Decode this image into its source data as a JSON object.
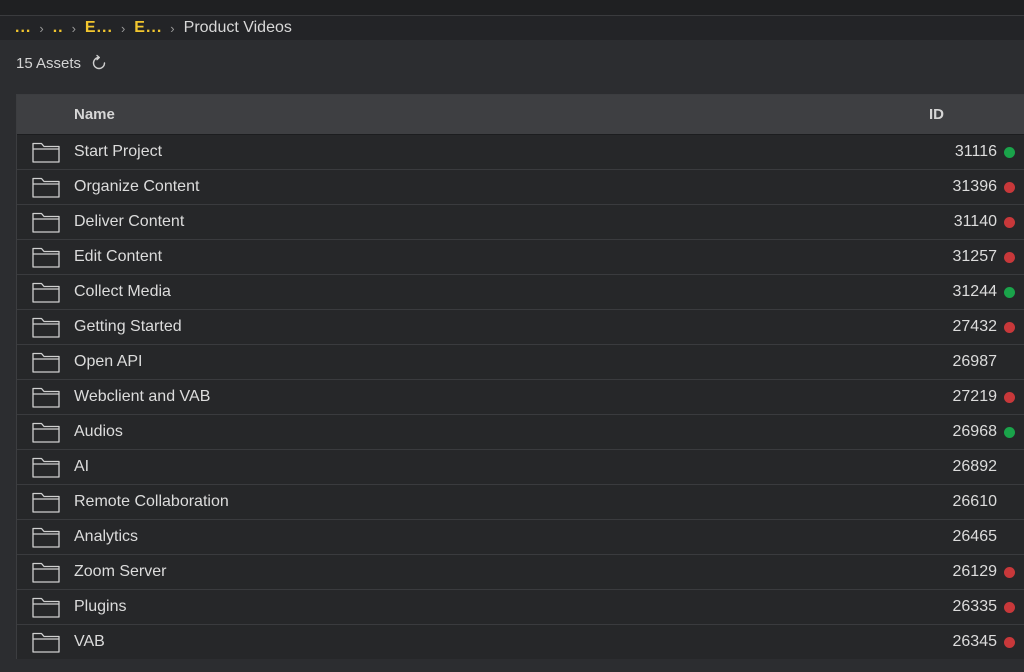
{
  "breadcrumb": {
    "items": [
      {
        "label": "...",
        "type": "link"
      },
      {
        "label": "..",
        "type": "link"
      },
      {
        "label": "E...",
        "type": "link"
      },
      {
        "label": "E...",
        "type": "link"
      },
      {
        "label": "Product Videos",
        "type": "current"
      }
    ],
    "separator": "›"
  },
  "assets": {
    "count_label": "15 Assets"
  },
  "table": {
    "columns": {
      "name": "Name",
      "id": "ID"
    },
    "rows": [
      {
        "name": "Start Project",
        "id": "31116",
        "status": "green"
      },
      {
        "name": "Organize Content",
        "id": "31396",
        "status": "red"
      },
      {
        "name": "Deliver Content",
        "id": "31140",
        "status": "red"
      },
      {
        "name": "Edit Content",
        "id": "31257",
        "status": "red"
      },
      {
        "name": "Collect Media",
        "id": "31244",
        "status": "green"
      },
      {
        "name": "Getting Started",
        "id": "27432",
        "status": "red"
      },
      {
        "name": "Open API",
        "id": "26987",
        "status": "none"
      },
      {
        "name": "Webclient and VAB",
        "id": "27219",
        "status": "red"
      },
      {
        "name": "Audios",
        "id": "26968",
        "status": "green"
      },
      {
        "name": "AI",
        "id": "26892",
        "status": "none"
      },
      {
        "name": "Remote Collaboration",
        "id": "26610",
        "status": "none"
      },
      {
        "name": "Analytics",
        "id": "26465",
        "status": "none"
      },
      {
        "name": "Zoom Server",
        "id": "26129",
        "status": "red"
      },
      {
        "name": "Plugins",
        "id": "26335",
        "status": "red"
      },
      {
        "name": "VAB",
        "id": "26345",
        "status": "red"
      }
    ]
  },
  "colors": {
    "accent_link": "#f2c62e",
    "status_green": "#1aa34a",
    "status_red": "#c8383a",
    "background": "#2c2d30"
  },
  "icons": {
    "row_icon": "folder-icon",
    "refresh": "refresh-icon"
  }
}
